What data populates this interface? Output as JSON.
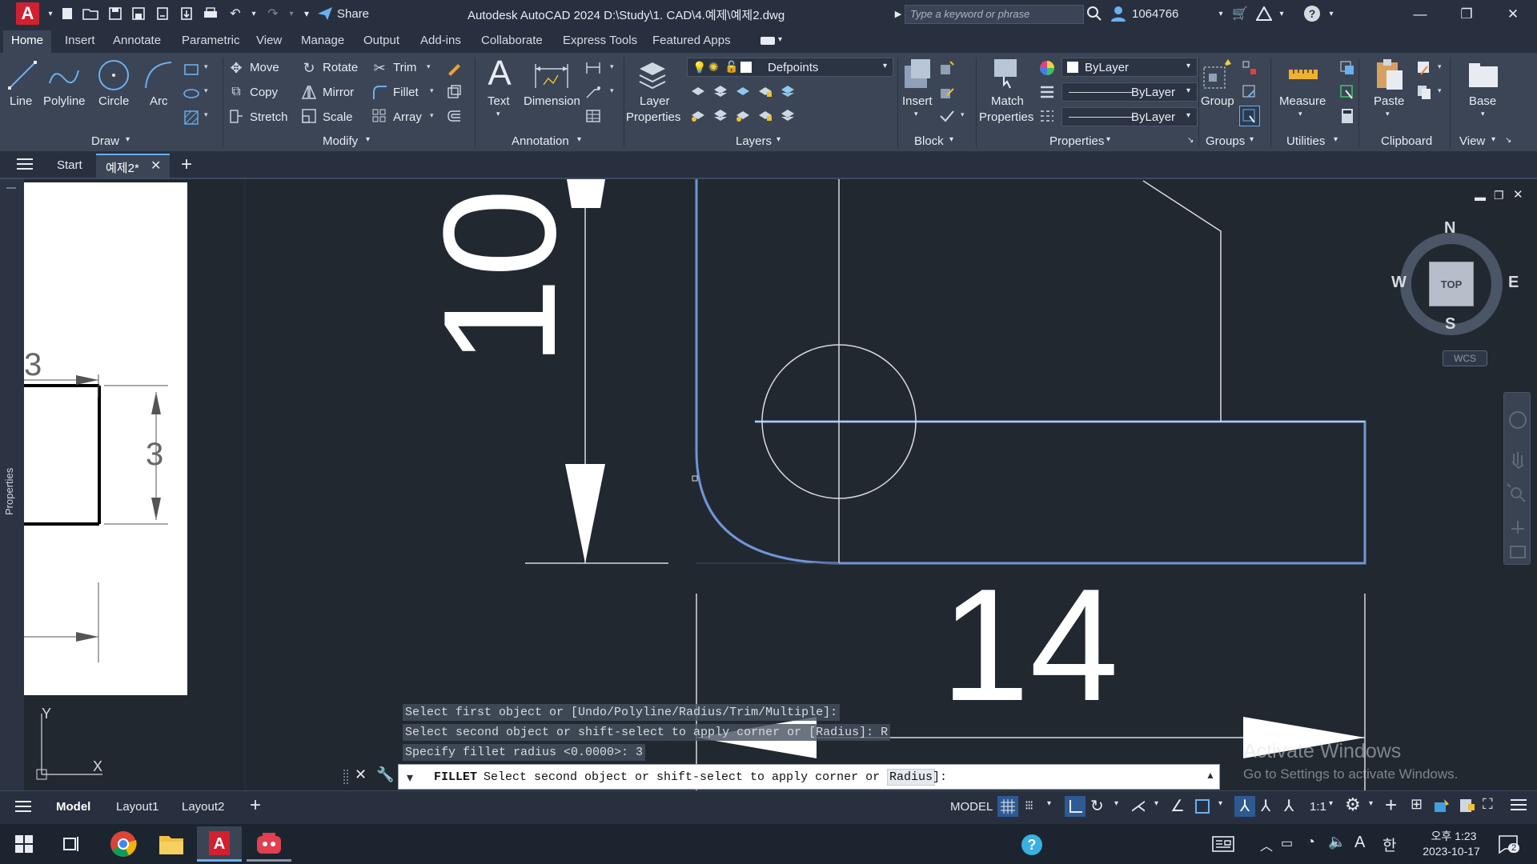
{
  "titlebar": {
    "app_letter": "A",
    "share_label": "Share",
    "title": "Autodesk AutoCAD 2024    D:\\Study\\1. CAD\\4.예제\\예제2.dwg",
    "search_placeholder": "Type a keyword or phrase",
    "user": "1064766"
  },
  "ribbon_tabs": [
    "Home",
    "Insert",
    "Annotate",
    "Parametric",
    "View",
    "Manage",
    "Output",
    "Add-ins",
    "Collaborate",
    "Express Tools",
    "Featured Apps"
  ],
  "ribbon": {
    "draw": {
      "line": "Line",
      "polyline": "Polyline",
      "circle": "Circle",
      "arc": "Arc",
      "title": "Draw"
    },
    "modify": {
      "move": "Move",
      "rotate": "Rotate",
      "trim": "Trim",
      "copy": "Copy",
      "mirror": "Mirror",
      "fillet": "Fillet",
      "stretch": "Stretch",
      "scale": "Scale",
      "array": "Array",
      "title": "Modify"
    },
    "annotation": {
      "text": "Text",
      "dimension": "Dimension",
      "title": "Annotation"
    },
    "layers": {
      "layer_properties_1": "Layer",
      "layer_properties_2": "Properties",
      "current_layer": "Defpoints",
      "title": "Layers"
    },
    "block": {
      "insert": "Insert",
      "title": "Block"
    },
    "properties": {
      "match_1": "Match",
      "match_2": "Properties",
      "color": "ByLayer",
      "linetype": "ByLayer",
      "lineweight": "ByLayer",
      "title": "Properties"
    },
    "groups": {
      "group": "Group",
      "title": "Groups"
    },
    "utilities": {
      "measure": "Measure",
      "title": "Utilities"
    },
    "clipboard": {
      "paste": "Paste",
      "title": "Clipboard"
    },
    "view": {
      "base": "Base",
      "title": "View"
    }
  },
  "filetabs": {
    "start": "Start",
    "active": "예제2*"
  },
  "viewcube": {
    "n": "N",
    "s": "S",
    "e": "E",
    "w": "W",
    "top": "TOP",
    "wcs": "WCS"
  },
  "side_panel": {
    "label": "Properties"
  },
  "drawing": {
    "dim_vertical": "10",
    "dim_horizontal": "14",
    "small_dim_a": "3",
    "small_dim_b": "3",
    "ucs_x": "X",
    "ucs_y": "Y"
  },
  "command_history": [
    "Select first object or [Undo/Polyline/Radius/Trim/Multiple]:",
    "Select second object or shift-select to apply corner or [Radius]: R",
    "Specify fillet radius <0.0000>: 3"
  ],
  "command_line": {
    "command": "FILLET",
    "prompt_before": "Select second object or shift-select to apply corner or [",
    "option": "Radius",
    "prompt_after": "]:"
  },
  "watermark": {
    "line1": "Activate Windows",
    "line2": "Go to Settings to activate Windows."
  },
  "statusbar": {
    "tabs": [
      "Model",
      "Layout1",
      "Layout2"
    ],
    "space": "MODEL",
    "scale": "1:1"
  },
  "taskbar": {
    "time": "오후 1:23",
    "date": "2023-10-17",
    "ime": "A",
    "lang": "한",
    "notifications": "2"
  }
}
